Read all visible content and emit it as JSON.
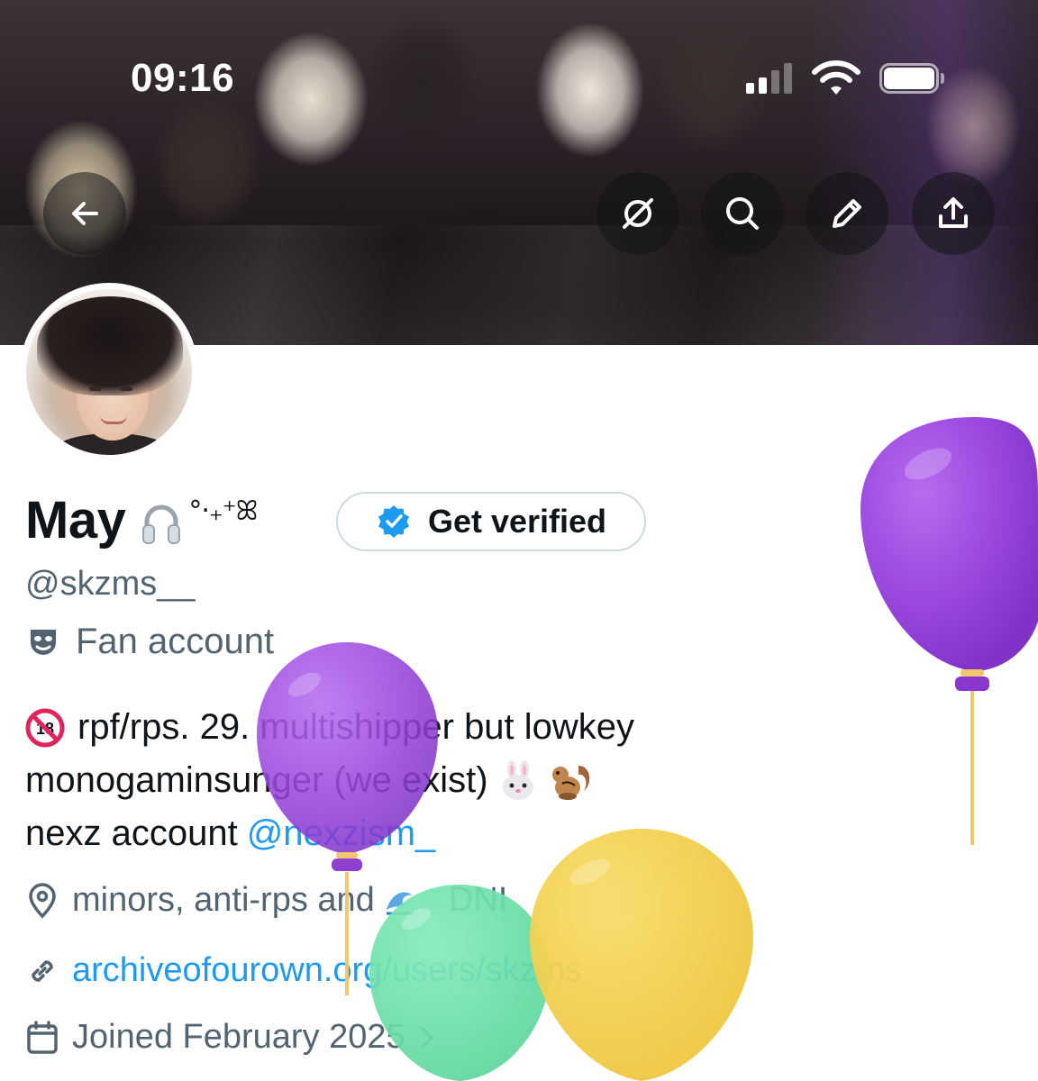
{
  "status_bar": {
    "time": "09:16"
  },
  "header": {
    "back_icon": "arrow-left-icon",
    "actions": [
      {
        "icon": "no-grok-icon"
      },
      {
        "icon": "search-icon"
      },
      {
        "icon": "pencil-icon"
      },
      {
        "icon": "share-icon"
      }
    ]
  },
  "profile": {
    "display_name": "May",
    "name_decoration": "°‧₊⁺ꕤ",
    "get_verified_label": "Get verified",
    "handle": "@skzms__",
    "category": "Fan account",
    "bio": {
      "line1_text": "rpf/rps. 29. multishipper but lowkey",
      "line2_text": "monogaminsunger (we exist)",
      "line3_text": "nexz account",
      "line3_mention": "@nexzism_"
    },
    "location": "minors, anti-rps and",
    "location_suffix": "DNI",
    "website": "archiveofourown.org/users/skzms",
    "joined": "Joined February 2025"
  },
  "colors": {
    "text_primary": "#0f1419",
    "text_secondary": "#536471",
    "link": "#1d9bf0",
    "verified_badge": "#1d9bf0",
    "balloon_purple": "#9b4fe0",
    "balloon_yellow": "#f4d04e",
    "balloon_green": "#6ee0a8"
  }
}
